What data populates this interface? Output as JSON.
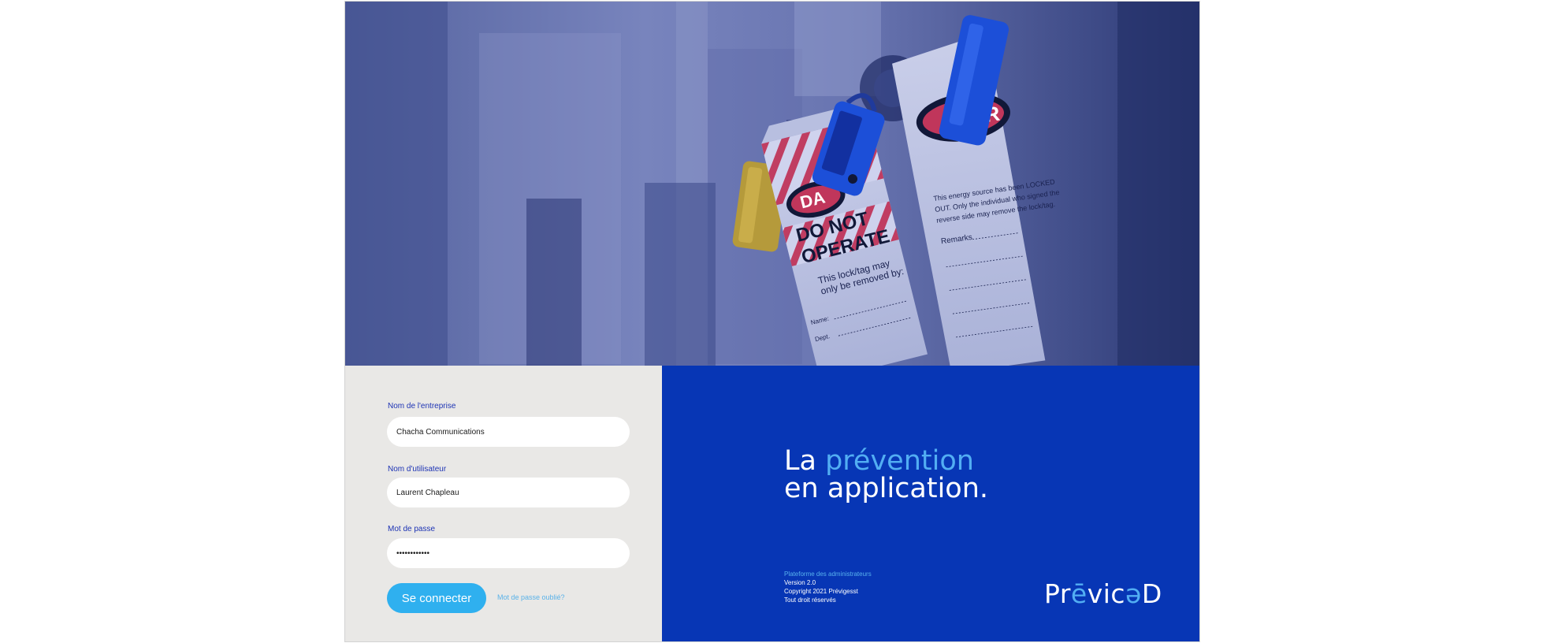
{
  "form": {
    "company_label": "Nom de l'entreprise",
    "company_value": "Chacha Communications",
    "username_label": "Nom d'utilisateur",
    "username_value": "Laurent Chapleau",
    "password_label": "Mot de passe",
    "password_value": "••••••••••••",
    "login_button": "Se connecter",
    "forgot_link": "Mot de passe oublié?"
  },
  "hero": {
    "tag_left_text_1": "DA",
    "tag_left_text_2": "DO NOT",
    "tag_left_text_3": "OPERATE",
    "tag_left_text_4": "This lock/tag may",
    "tag_left_text_5": "only be removed by:",
    "tag_left_text_6": "Name:",
    "tag_left_text_7": "Dept.",
    "tag_right_text_1": "GER",
    "tag_right_text_2": "This energy source has been LOCKED",
    "tag_right_text_3": "OUT. Only the individual who signed the",
    "tag_right_text_4": "reverse side may remove the lock/tag.",
    "tag_right_text_5": "Remarks"
  },
  "brand": {
    "tagline_la": "La",
    "tagline_prevention": "prévention",
    "tagline_line2": "en application.",
    "platform": "Plateforme des administrateurs",
    "version": "Version 2.0",
    "copyright": "Copyright 2021 Prévigesst",
    "rights": "Tout droit réservés",
    "logo_part1": "Pr",
    "logo_accent1": "ē",
    "logo_part2": "vic",
    "logo_accent2": "ə",
    "logo_part3": "D"
  },
  "colors": {
    "brand_blue": "#0736b5",
    "accent_blue": "#52aef3",
    "button_blue": "#2fb0ef",
    "label_blue": "#1d33b4",
    "form_bg": "#e9e8e6"
  }
}
